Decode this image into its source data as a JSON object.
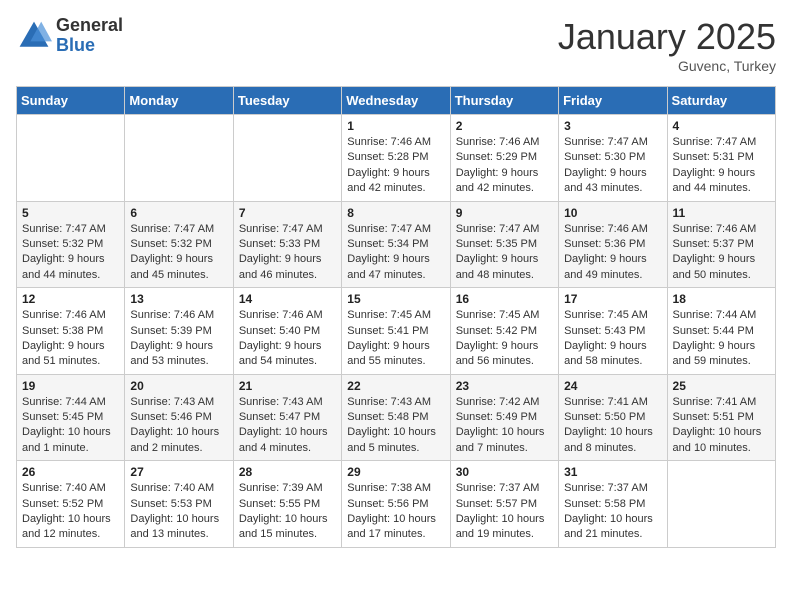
{
  "header": {
    "logo_general": "General",
    "logo_blue": "Blue",
    "month_title": "January 2025",
    "location": "Guvenc, Turkey"
  },
  "weekdays": [
    "Sunday",
    "Monday",
    "Tuesday",
    "Wednesday",
    "Thursday",
    "Friday",
    "Saturday"
  ],
  "weeks": [
    [
      {
        "day": "",
        "sunrise": "",
        "sunset": "",
        "daylight": ""
      },
      {
        "day": "",
        "sunrise": "",
        "sunset": "",
        "daylight": ""
      },
      {
        "day": "",
        "sunrise": "",
        "sunset": "",
        "daylight": ""
      },
      {
        "day": "1",
        "sunrise": "Sunrise: 7:46 AM",
        "sunset": "Sunset: 5:28 PM",
        "daylight": "Daylight: 9 hours and 42 minutes."
      },
      {
        "day": "2",
        "sunrise": "Sunrise: 7:46 AM",
        "sunset": "Sunset: 5:29 PM",
        "daylight": "Daylight: 9 hours and 42 minutes."
      },
      {
        "day": "3",
        "sunrise": "Sunrise: 7:47 AM",
        "sunset": "Sunset: 5:30 PM",
        "daylight": "Daylight: 9 hours and 43 minutes."
      },
      {
        "day": "4",
        "sunrise": "Sunrise: 7:47 AM",
        "sunset": "Sunset: 5:31 PM",
        "daylight": "Daylight: 9 hours and 44 minutes."
      }
    ],
    [
      {
        "day": "5",
        "sunrise": "Sunrise: 7:47 AM",
        "sunset": "Sunset: 5:32 PM",
        "daylight": "Daylight: 9 hours and 44 minutes."
      },
      {
        "day": "6",
        "sunrise": "Sunrise: 7:47 AM",
        "sunset": "Sunset: 5:32 PM",
        "daylight": "Daylight: 9 hours and 45 minutes."
      },
      {
        "day": "7",
        "sunrise": "Sunrise: 7:47 AM",
        "sunset": "Sunset: 5:33 PM",
        "daylight": "Daylight: 9 hours and 46 minutes."
      },
      {
        "day": "8",
        "sunrise": "Sunrise: 7:47 AM",
        "sunset": "Sunset: 5:34 PM",
        "daylight": "Daylight: 9 hours and 47 minutes."
      },
      {
        "day": "9",
        "sunrise": "Sunrise: 7:47 AM",
        "sunset": "Sunset: 5:35 PM",
        "daylight": "Daylight: 9 hours and 48 minutes."
      },
      {
        "day": "10",
        "sunrise": "Sunrise: 7:46 AM",
        "sunset": "Sunset: 5:36 PM",
        "daylight": "Daylight: 9 hours and 49 minutes."
      },
      {
        "day": "11",
        "sunrise": "Sunrise: 7:46 AM",
        "sunset": "Sunset: 5:37 PM",
        "daylight": "Daylight: 9 hours and 50 minutes."
      }
    ],
    [
      {
        "day": "12",
        "sunrise": "Sunrise: 7:46 AM",
        "sunset": "Sunset: 5:38 PM",
        "daylight": "Daylight: 9 hours and 51 minutes."
      },
      {
        "day": "13",
        "sunrise": "Sunrise: 7:46 AM",
        "sunset": "Sunset: 5:39 PM",
        "daylight": "Daylight: 9 hours and 53 minutes."
      },
      {
        "day": "14",
        "sunrise": "Sunrise: 7:46 AM",
        "sunset": "Sunset: 5:40 PM",
        "daylight": "Daylight: 9 hours and 54 minutes."
      },
      {
        "day": "15",
        "sunrise": "Sunrise: 7:45 AM",
        "sunset": "Sunset: 5:41 PM",
        "daylight": "Daylight: 9 hours and 55 minutes."
      },
      {
        "day": "16",
        "sunrise": "Sunrise: 7:45 AM",
        "sunset": "Sunset: 5:42 PM",
        "daylight": "Daylight: 9 hours and 56 minutes."
      },
      {
        "day": "17",
        "sunrise": "Sunrise: 7:45 AM",
        "sunset": "Sunset: 5:43 PM",
        "daylight": "Daylight: 9 hours and 58 minutes."
      },
      {
        "day": "18",
        "sunrise": "Sunrise: 7:44 AM",
        "sunset": "Sunset: 5:44 PM",
        "daylight": "Daylight: 9 hours and 59 minutes."
      }
    ],
    [
      {
        "day": "19",
        "sunrise": "Sunrise: 7:44 AM",
        "sunset": "Sunset: 5:45 PM",
        "daylight": "Daylight: 10 hours and 1 minute."
      },
      {
        "day": "20",
        "sunrise": "Sunrise: 7:43 AM",
        "sunset": "Sunset: 5:46 PM",
        "daylight": "Daylight: 10 hours and 2 minutes."
      },
      {
        "day": "21",
        "sunrise": "Sunrise: 7:43 AM",
        "sunset": "Sunset: 5:47 PM",
        "daylight": "Daylight: 10 hours and 4 minutes."
      },
      {
        "day": "22",
        "sunrise": "Sunrise: 7:43 AM",
        "sunset": "Sunset: 5:48 PM",
        "daylight": "Daylight: 10 hours and 5 minutes."
      },
      {
        "day": "23",
        "sunrise": "Sunrise: 7:42 AM",
        "sunset": "Sunset: 5:49 PM",
        "daylight": "Daylight: 10 hours and 7 minutes."
      },
      {
        "day": "24",
        "sunrise": "Sunrise: 7:41 AM",
        "sunset": "Sunset: 5:50 PM",
        "daylight": "Daylight: 10 hours and 8 minutes."
      },
      {
        "day": "25",
        "sunrise": "Sunrise: 7:41 AM",
        "sunset": "Sunset: 5:51 PM",
        "daylight": "Daylight: 10 hours and 10 minutes."
      }
    ],
    [
      {
        "day": "26",
        "sunrise": "Sunrise: 7:40 AM",
        "sunset": "Sunset: 5:52 PM",
        "daylight": "Daylight: 10 hours and 12 minutes."
      },
      {
        "day": "27",
        "sunrise": "Sunrise: 7:40 AM",
        "sunset": "Sunset: 5:53 PM",
        "daylight": "Daylight: 10 hours and 13 minutes."
      },
      {
        "day": "28",
        "sunrise": "Sunrise: 7:39 AM",
        "sunset": "Sunset: 5:55 PM",
        "daylight": "Daylight: 10 hours and 15 minutes."
      },
      {
        "day": "29",
        "sunrise": "Sunrise: 7:38 AM",
        "sunset": "Sunset: 5:56 PM",
        "daylight": "Daylight: 10 hours and 17 minutes."
      },
      {
        "day": "30",
        "sunrise": "Sunrise: 7:37 AM",
        "sunset": "Sunset: 5:57 PM",
        "daylight": "Daylight: 10 hours and 19 minutes."
      },
      {
        "day": "31",
        "sunrise": "Sunrise: 7:37 AM",
        "sunset": "Sunset: 5:58 PM",
        "daylight": "Daylight: 10 hours and 21 minutes."
      },
      {
        "day": "",
        "sunrise": "",
        "sunset": "",
        "daylight": ""
      }
    ]
  ]
}
